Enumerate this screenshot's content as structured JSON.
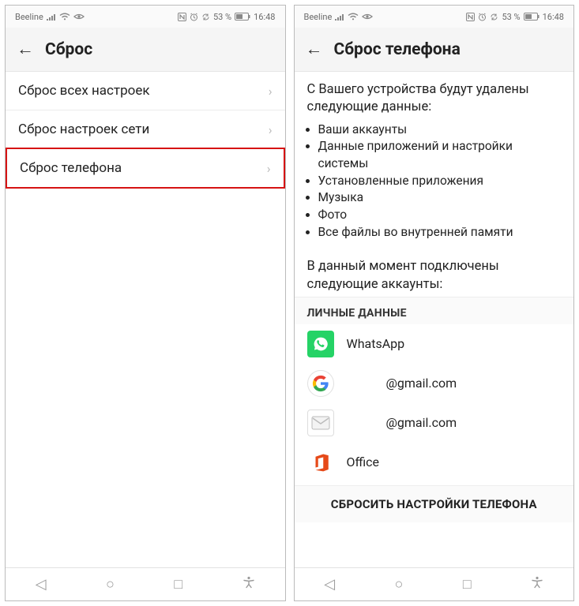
{
  "statusbar": {
    "carrier": "Beeline",
    "battery_text": "53 %",
    "time": "16:48"
  },
  "left": {
    "title": "Сброс",
    "items": [
      {
        "label": "Сброс всех настроек"
      },
      {
        "label": "Сброс настроек сети"
      },
      {
        "label": "Сброс телефона"
      }
    ]
  },
  "right": {
    "title": "Сброс телефона",
    "intro": "С Вашего устройства будут удалены следующие данные:",
    "bullets": [
      "Ваши аккаунты",
      "Данные приложений и настройки системы",
      "Установленные приложения",
      "Музыка",
      "Фото",
      "Все файлы во внутренней памяти"
    ],
    "accounts_intro": "В данный момент подключены следующие аккаунты:",
    "section": "ЛИЧНЫЕ ДАННЫЕ",
    "accounts": [
      {
        "name": "WhatsApp",
        "icon": "whatsapp"
      },
      {
        "name": "@gmail.com",
        "icon": "google"
      },
      {
        "name": "@gmail.com",
        "icon": "mail"
      },
      {
        "name": "Office",
        "icon": "office"
      }
    ],
    "reset_button": "СБРОСИТЬ НАСТРОЙКИ ТЕЛЕФОНА"
  }
}
